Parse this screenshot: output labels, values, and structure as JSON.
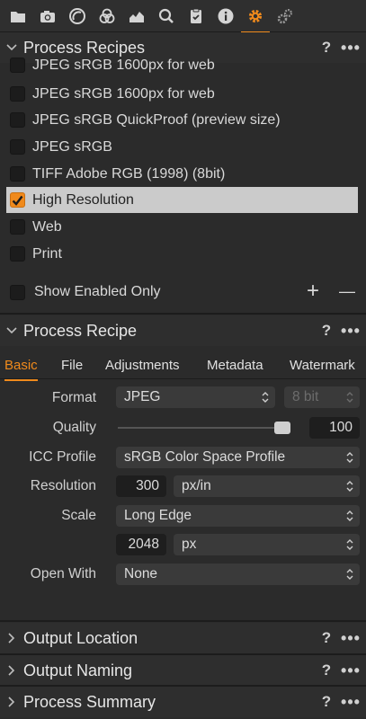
{
  "toolbar": {
    "icons": [
      "folder-icon",
      "camera-icon",
      "lens-icon",
      "color-icon",
      "exposure-icon",
      "details-icon",
      "adjustments-icon",
      "metadata-icon",
      "output-icon",
      "batch-icon"
    ],
    "active": "output-icon",
    "accent": "#f08a1c"
  },
  "recipes_panel": {
    "title": "Process Recipes",
    "help": "?",
    "more": "•••",
    "partial_item": "JPEG sRGB 1600px for web",
    "items": [
      {
        "label": "JPEG sRGB 1600px for web",
        "checked": false
      },
      {
        "label": "JPEG sRGB QuickProof (preview size)",
        "checked": false
      },
      {
        "label": "JPEG sRGB",
        "checked": false
      },
      {
        "label": "TIFF Adobe RGB (1998) (8bit)",
        "checked": false
      },
      {
        "label": "High Resolution",
        "checked": true
      },
      {
        "label": "Web",
        "checked": false
      },
      {
        "label": "Print",
        "checked": false
      }
    ],
    "show_enabled_only": "Show Enabled Only",
    "add": "+",
    "remove": "—"
  },
  "recipe_panel": {
    "title": "Process Recipe",
    "help": "?",
    "more": "•••",
    "tabs": [
      "Basic",
      "File",
      "Adjustments",
      "Metadata",
      "Watermark"
    ],
    "active_tab": "Basic",
    "format": {
      "label": "Format",
      "value": "JPEG",
      "bit_depth": "8 bit"
    },
    "quality": {
      "label": "Quality",
      "value": "100",
      "level": 1.0
    },
    "icc": {
      "label": "ICC Profile",
      "value": "sRGB Color Space Profile"
    },
    "resolution": {
      "label": "Resolution",
      "value": "300",
      "unit": "px/in"
    },
    "scale": {
      "label": "Scale",
      "value": "Long Edge",
      "size": "2048",
      "unit": "px"
    },
    "open_with": {
      "label": "Open With",
      "value": "None"
    }
  },
  "collapsed_sections": [
    {
      "title": "Output Location",
      "help": "?",
      "more": "•••"
    },
    {
      "title": "Output Naming",
      "help": "?",
      "more": "•••"
    },
    {
      "title": "Process Summary",
      "help": "?",
      "more": "•••"
    }
  ]
}
